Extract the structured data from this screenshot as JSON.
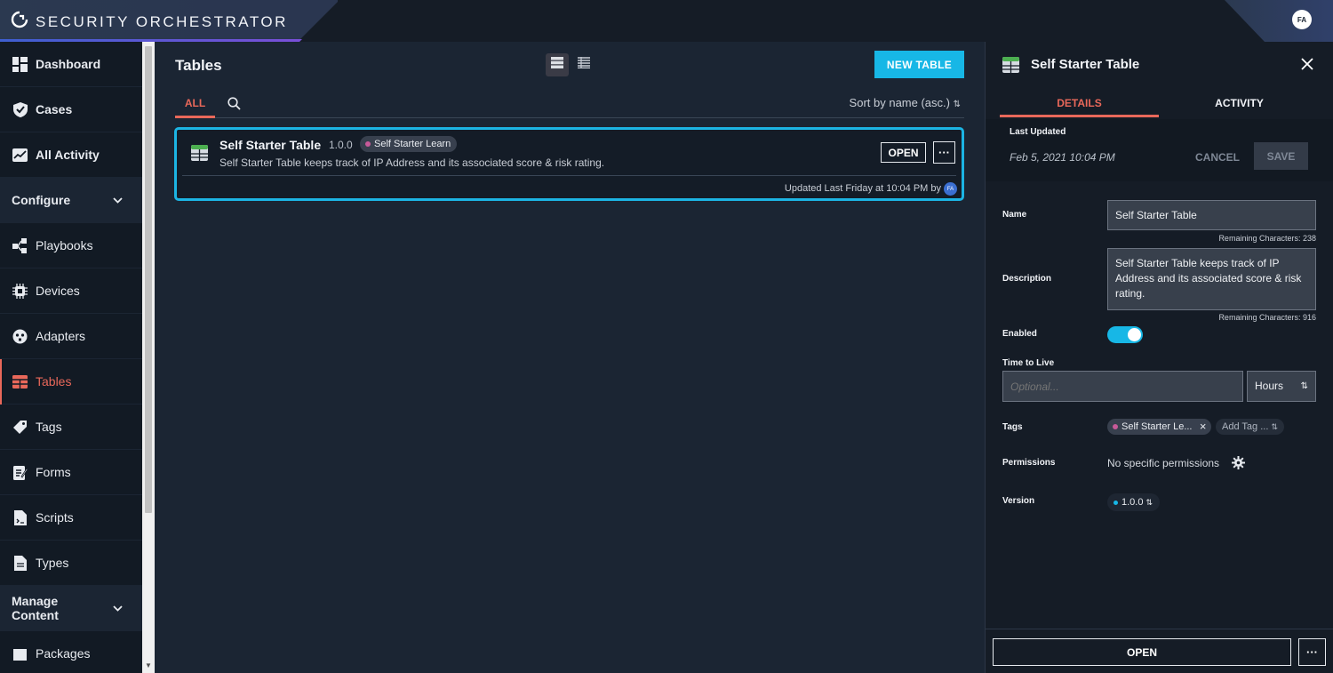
{
  "app": {
    "brand": "SECURITY ORCHESTRATOR",
    "user_initials": "FA"
  },
  "sidebar": {
    "items": [
      {
        "label": "Dashboard",
        "icon": "dashboard-icon"
      },
      {
        "label": "Cases",
        "icon": "shield-check-icon"
      },
      {
        "label": "All Activity",
        "icon": "activity-chart-icon"
      },
      {
        "label": "Configure",
        "section": true
      },
      {
        "label": "Playbooks",
        "icon": "playbook-flow-icon"
      },
      {
        "label": "Devices",
        "icon": "chip-icon"
      },
      {
        "label": "Adapters",
        "icon": "plug-icon"
      },
      {
        "label": "Tables",
        "icon": "table-icon",
        "active": true
      },
      {
        "label": "Tags",
        "icon": "tag-icon"
      },
      {
        "label": "Forms",
        "icon": "form-icon"
      },
      {
        "label": "Scripts",
        "icon": "script-icon"
      },
      {
        "label": "Types",
        "icon": "type-file-icon"
      },
      {
        "label": "Manage Content",
        "section": true
      },
      {
        "label": "Packages",
        "icon": "package-icon"
      }
    ]
  },
  "main": {
    "title": "Tables",
    "new_button": "NEW TABLE",
    "tab_all": "ALL",
    "sort_label": "Sort by name (asc.)",
    "card": {
      "title": "Self Starter Table",
      "version": "1.0.0",
      "tag": "Self Starter Learn",
      "description": "Self Starter Table keeps track of IP Address and its associated score & risk rating.",
      "open_label": "OPEN",
      "more_label": "···",
      "updated": "Updated Last Friday at 10:04 PM by",
      "avatar": "FA"
    }
  },
  "panel": {
    "title": "Self Starter Table",
    "tabs": {
      "details": "DETAILS",
      "activity": "ACTIVITY"
    },
    "last_updated_label": "Last Updated",
    "last_updated_value": "Feb 5, 2021 10:04 PM",
    "cancel": "CANCEL",
    "save": "SAVE",
    "name_label": "Name",
    "name_value": "Self Starter Table",
    "name_remaining": "Remaining Characters: 238",
    "description_label": "Description",
    "description_value": "Self Starter Table keeps track of IP Address and its associated score & risk rating.",
    "description_remaining": "Remaining Characters: 916",
    "enabled_label": "Enabled",
    "enabled": true,
    "ttl_label": "Time to Live",
    "ttl_placeholder": "Optional...",
    "ttl_unit": "Hours",
    "tags_label": "Tags",
    "tag_value": "Self Starter Le...",
    "add_tag": "Add Tag ...",
    "permissions_label": "Permissions",
    "permissions_value": "No specific permissions",
    "version_label": "Version",
    "version_value": "1.0.0",
    "open_label": "OPEN",
    "more_label": "···"
  },
  "colors": {
    "accent": "#17b7e6",
    "active": "#e9685a",
    "tag_dot": "#c75a99"
  }
}
